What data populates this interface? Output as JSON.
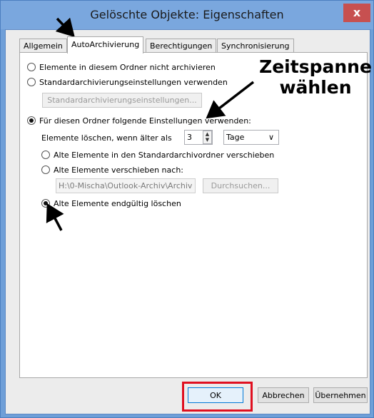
{
  "window": {
    "title": "Gelöschte Objekte: Eigenschaften",
    "close_icon": "close-icon",
    "close_glyph": "x",
    "close_color": "#c75050"
  },
  "tabs": [
    {
      "label": "Allgemein",
      "active": false
    },
    {
      "label": "AutoArchivierung",
      "active": true
    },
    {
      "label": "Berechtigungen",
      "active": false
    },
    {
      "label": "Synchronisierung",
      "active": false
    }
  ],
  "options": {
    "no_archive": "Elemente in diesem Ordner nicht archivieren",
    "default_archive": "Standardarchivierungseinstellungen verwenden",
    "default_settings_button": "Standardarchivierungseinstellungen...",
    "custom_archive": "Für diesen Ordner folgende Einstellungen verwenden:",
    "delete_older_label": "Elemente löschen, wenn älter als",
    "age_value": "3",
    "age_unit": "Tage",
    "move_default": "Alte Elemente in den Standardarchivordner verschieben",
    "move_to": "Alte Elemente verschieben nach:",
    "path_value": "H:\\0-Mischa\\Outlook-Archiv\\Archiv",
    "browse_button": "Durchsuchen...",
    "delete_permanently": "Alte Elemente endgültig löschen"
  },
  "footer": {
    "ok": "OK",
    "cancel": "Abbrechen",
    "apply": "Übernehmen"
  },
  "annotation": {
    "line1": "Zeitspanne",
    "line2": "wählen",
    "highlight_color": "#e01020"
  }
}
